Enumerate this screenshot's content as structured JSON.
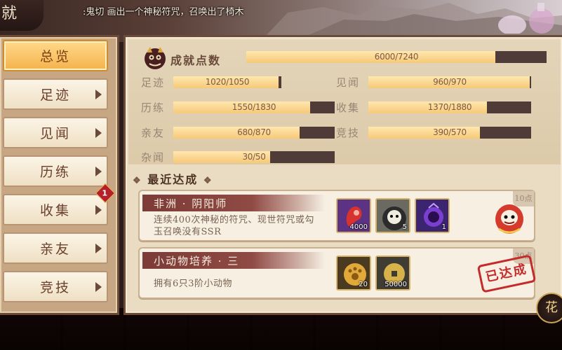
{
  "header": {
    "title": "就",
    "marquee": ":鬼切 画出一个神秘符咒，召唤出了椅木"
  },
  "sidebar": {
    "items": [
      {
        "label": "总览",
        "active": true,
        "arrow": false
      },
      {
        "label": "足迹",
        "active": false,
        "arrow": true
      },
      {
        "label": "见闻",
        "active": false,
        "arrow": true
      },
      {
        "label": "历练",
        "active": false,
        "arrow": true
      },
      {
        "label": "收集",
        "active": false,
        "arrow": true
      },
      {
        "label": "亲友",
        "active": false,
        "arrow": true
      },
      {
        "label": "竞技",
        "active": false,
        "arrow": true
      }
    ],
    "badge": "1"
  },
  "summary": {
    "score_label": "成就点数",
    "score_value": "6000/7240",
    "score_progress": 0.829,
    "stats": [
      {
        "label": "足迹",
        "value": "1020/1050",
        "progress": 0.971
      },
      {
        "label": "见闻",
        "value": "960/970",
        "progress": 0.99
      },
      {
        "label": "历练",
        "value": "1550/1830",
        "progress": 0.847
      },
      {
        "label": "收集",
        "value": "1370/1880",
        "progress": 0.729
      },
      {
        "label": "亲友",
        "value": "680/870",
        "progress": 0.782
      },
      {
        "label": "竞技",
        "value": "390/570",
        "progress": 0.684
      },
      {
        "label": "杂闻",
        "value": "30/50",
        "progress": 0.6
      }
    ]
  },
  "recent": {
    "title": "最近达成",
    "deco": "❖",
    "cards": [
      {
        "title": "非洲 · 阴阳师",
        "description": "连续400次神秘的符咒、现世符咒或勾玉召唤没有SSR",
        "points": "10点",
        "rewards": [
          {
            "icon": "red-magatama-icon",
            "count": "4000"
          },
          {
            "icon": "daruma-doll-icon",
            "count": "5"
          },
          {
            "icon": "purple-orb-icon",
            "count": "1"
          }
        ],
        "achieved": false
      },
      {
        "title": "小动物培养 · 三",
        "description": "拥有6只3阶小动物",
        "points": "30点",
        "rewards": [
          {
            "icon": "paw-coin-icon",
            "count": "20"
          },
          {
            "icon": "gold-coin-icon",
            "count": "50000"
          }
        ],
        "achieved": true,
        "stamp": "已达成"
      }
    ]
  },
  "corner_button": "花"
}
